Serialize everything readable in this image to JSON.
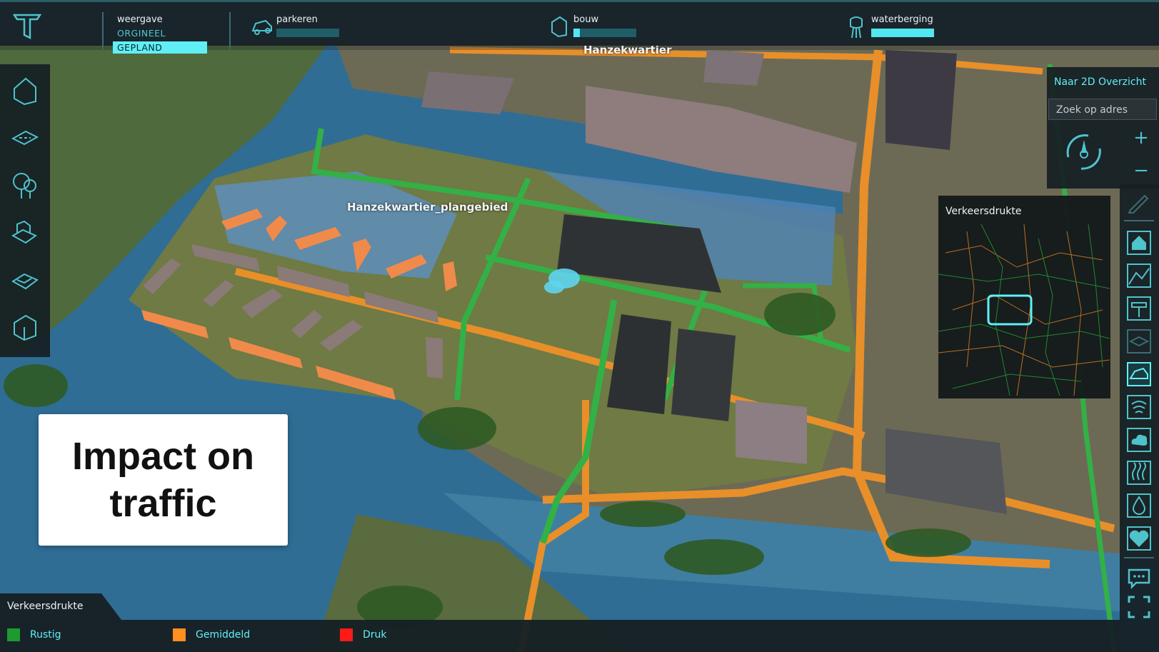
{
  "topbar": {
    "view_title": "weergave",
    "view_options": [
      "ORGINEEL",
      "GEPLAND"
    ],
    "view_selected": "GEPLAND",
    "indicators": [
      {
        "name": "parkeren",
        "icon": "car-icon",
        "level": 0.0
      },
      {
        "name": "bouw",
        "icon": "building-icon",
        "level": 0.1
      },
      {
        "name": "waterberging",
        "icon": "water-tower-icon",
        "level": 1.0
      }
    ]
  },
  "map": {
    "area_label": "Hanzekwartier",
    "plan_label": "Hanzekwartier_plangebied"
  },
  "navigation": {
    "overview_link": "Naar 2D Overzicht",
    "search_placeholder": "Zoek op adres",
    "zoom_in": "+",
    "zoom_out": "−"
  },
  "minimap": {
    "title": "Verkeersdrukte"
  },
  "legend": {
    "title": "Verkeersdrukte",
    "items": [
      {
        "label": "Rustig",
        "color": "#1e9b2f"
      },
      {
        "label": "Gemiddeld",
        "color": "#ff8f1f"
      },
      {
        "label": "Druk",
        "color": "#ff1a1a"
      }
    ]
  },
  "overlay_card": {
    "text": "Impact on traffic"
  },
  "colors": {
    "accent": "#5ff0f7",
    "panel": "#161f23"
  }
}
